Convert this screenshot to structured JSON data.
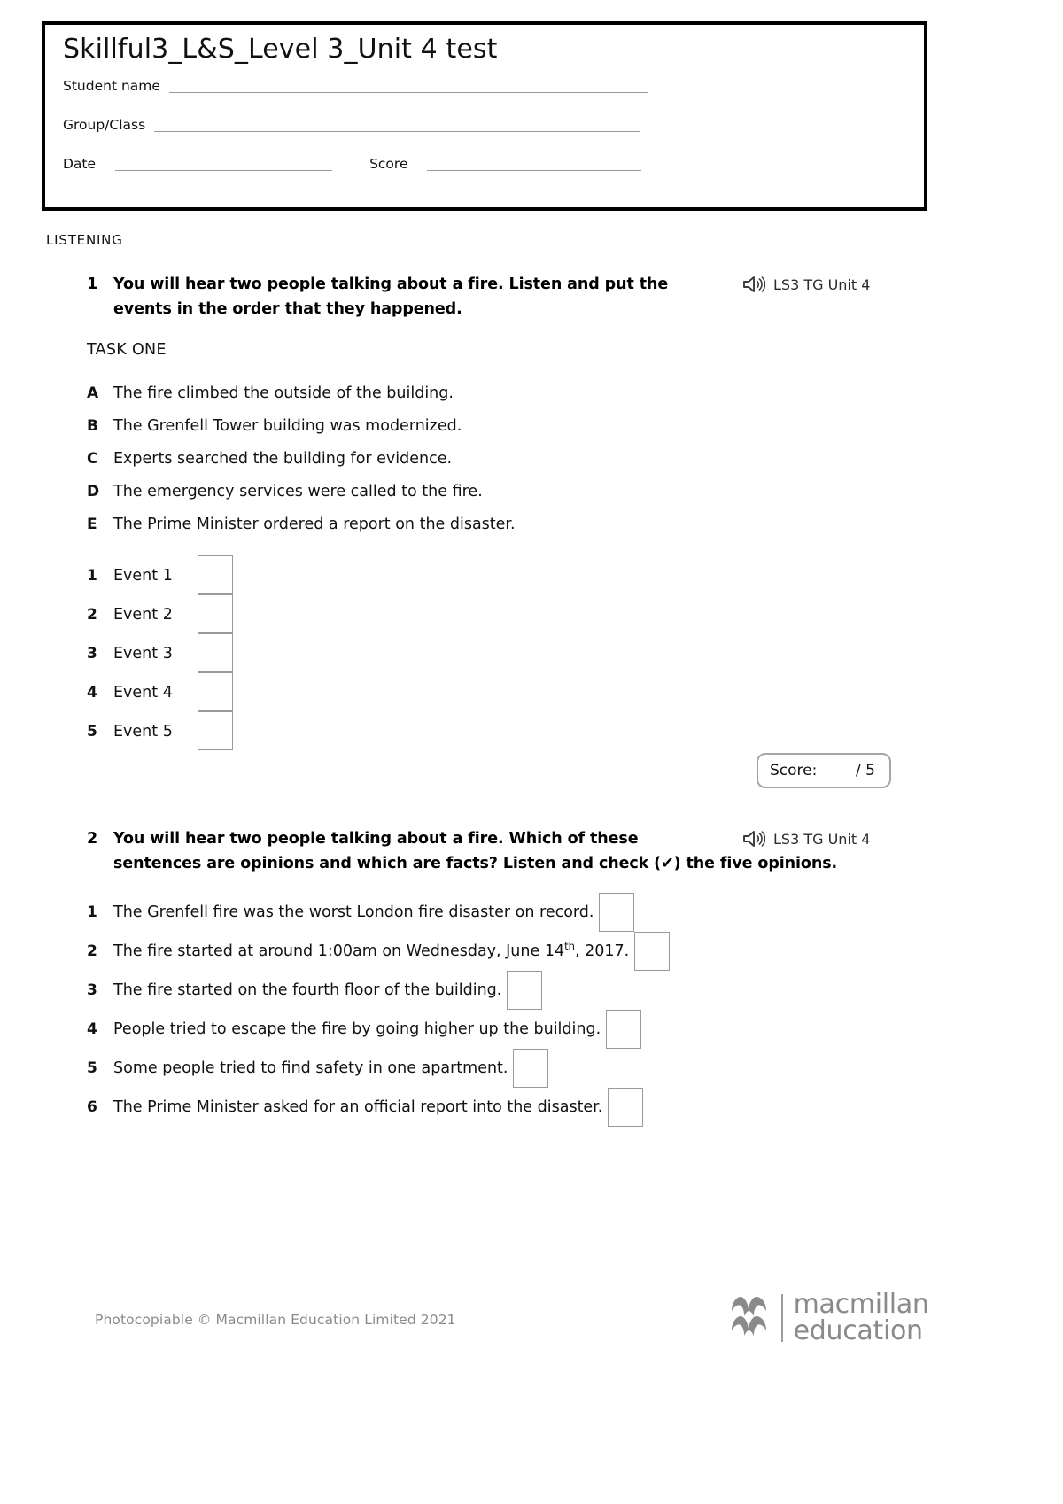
{
  "header": {
    "title": "Skillful3_L&S_Level 3_Unit 4 test",
    "fields": [
      {
        "label": "Student name"
      },
      {
        "label": "Group/Class"
      },
      {
        "label": "Date"
      },
      {
        "label": "Score"
      }
    ],
    "student_name_label": "Student name",
    "group_class_label": "Group/Class",
    "date_label": "Date",
    "score_label": "Score",
    "student_name_value": "",
    "group_class_value": "",
    "date_value": "",
    "score_value": ""
  },
  "section": {
    "heading": "LISTENING"
  },
  "questions": [
    {
      "number": "1",
      "prompt": "You will hear two people talking about a fire. Listen and put the events in the order that they happened.",
      "audio_icon": "speaker-icon",
      "audio_label": "LS3 TG Unit 4",
      "task_label": "TASK ONE",
      "options": [
        {
          "letter": "A",
          "text": "The fire climbed the outside of the building."
        },
        {
          "letter": "B",
          "text": "The Grenfell Tower building was modernized."
        },
        {
          "letter": "C",
          "text": "Experts searched the building for evidence."
        },
        {
          "letter": "D",
          "text": "The emergency services were called to the fire."
        },
        {
          "letter": "E",
          "text": "The Prime Minister ordered a report on the disaster."
        }
      ],
      "events": [
        {
          "number": "1",
          "label": "Event 1",
          "answer": ""
        },
        {
          "number": "2",
          "label": "Event 2",
          "answer": ""
        },
        {
          "number": "3",
          "label": "Event 3",
          "answer": ""
        },
        {
          "number": "4",
          "label": "Event 4",
          "answer": ""
        },
        {
          "number": "5",
          "label": "Event 5",
          "answer": ""
        }
      ],
      "score": {
        "label": "Score:",
        "total": "/ 5",
        "value": ""
      }
    },
    {
      "number": "2",
      "prompt_line1": "You will hear two people talking about a fire. Which of these",
      "prompt_line2": "sentences are opinions and which are facts? Listen and check (✔) the five opinions.",
      "audio_icon": "speaker-icon",
      "audio_label": "LS3 TG Unit 4",
      "statements": [
        {
          "number": "1",
          "text": "The Grenfell fire was the worst London fire disaster on record.",
          "checked": ""
        },
        {
          "number": "2",
          "text_pre": "The fire started at around 1:00am on Wednesday, June 14",
          "sup": "th",
          "text_post": ", 2017.",
          "checked": ""
        },
        {
          "number": "3",
          "text": "The fire started on the fourth floor of the building.",
          "checked": ""
        },
        {
          "number": "4",
          "text": "People tried to escape the fire by going higher up the building.",
          "checked": ""
        },
        {
          "number": "5",
          "text": "Some people tried to find safety in one apartment.",
          "checked": ""
        },
        {
          "number": "6",
          "text": "The Prime Minister asked for an official report into the disaster.",
          "checked": ""
        }
      ]
    }
  ],
  "footer": {
    "copyright": "Photocopiable © Macmillan Education Limited 2021",
    "logo_line1": "macmillan",
    "logo_line2": "education",
    "logo_icon": "macmillan-m-icon"
  },
  "colors": {
    "text": "#1a1a1a",
    "box_border": "#000000",
    "field_line": "#9b9b9b",
    "answer_box_border": "#9a9a9a",
    "footer_gray": "#8a8a8a"
  }
}
